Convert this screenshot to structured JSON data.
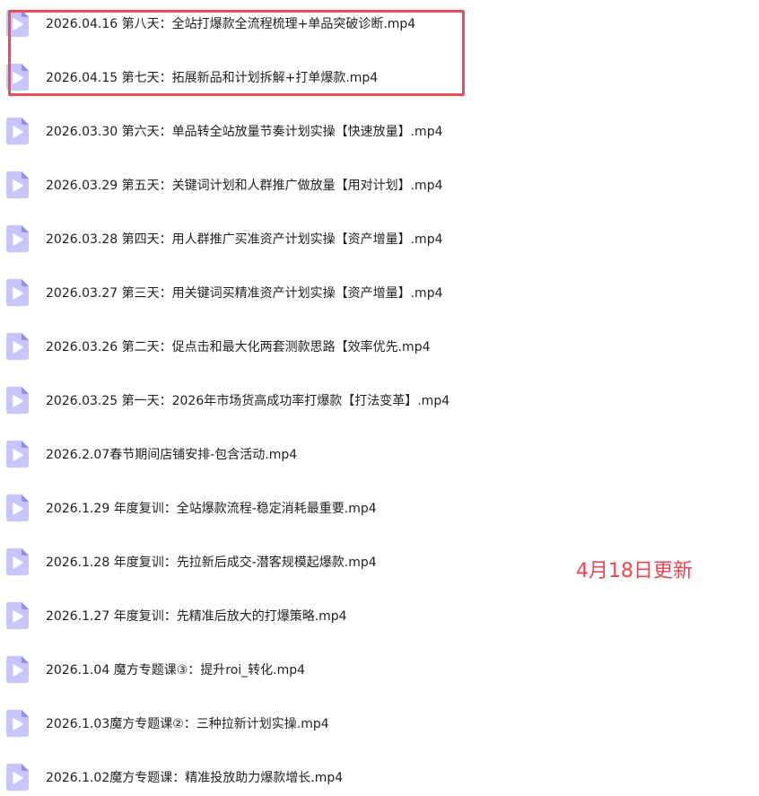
{
  "files": [
    "2026.04.16 第八天：全站打爆款全流程梳理+单品突破诊断.mp4",
    "2026.04.15 第七天：拓展新品和计划拆解+打单爆款.mp4",
    "2026.03.30 第六天：单品转全站放量节奏计划实操【快速放量】.mp4",
    "2026.03.29 第五天：关键词计划和人群推广做放量【用对计划】.mp4",
    "2026.03.28 第四天：用人群推广买准资产计划实操【资产增量】.mp4",
    "2026.03.27 第三天：用关键词买精准资产计划实操【资产增量】.mp4",
    "2026.03.26 第二天：促点击和最大化两套测款思路【效率优先.mp4",
    "2026.03.25 第一天：2026年市场货高成功率打爆款【打法变革】.mp4",
    "2026.2.07春节期间店铺安排-包含活动.mp4",
    "2026.1.29 年度复训：全站爆款流程-稳定消耗最重要.mp4",
    "2026.1.28 年度复训：先拉新后成交-潜客规模起爆款.mp4",
    "2026.1.27 年度复训：先精准后放大的打爆策略.mp4",
    "2026.1.04 魔方专题课③：提升roi_转化.mp4",
    "2026.1.03魔方专题课②：三种拉新计划实操.mp4",
    "2026.1.02魔方专题课：精准投放助力爆款增长.mp4"
  ],
  "icon": "video-file-icon",
  "update_note": "4月18日更新",
  "colors": {
    "icon_light": "#c7c5fb",
    "icon_dark": "#8f8cf2",
    "highlight_border": "#ec4d5a",
    "note_text": "#ee4550"
  }
}
